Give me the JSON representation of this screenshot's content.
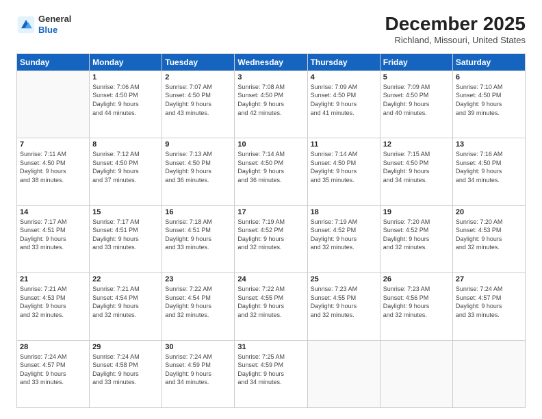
{
  "logo": {
    "general": "General",
    "blue": "Blue"
  },
  "header": {
    "month": "December 2025",
    "location": "Richland, Missouri, United States"
  },
  "days_of_week": [
    "Sunday",
    "Monday",
    "Tuesday",
    "Wednesday",
    "Thursday",
    "Friday",
    "Saturday"
  ],
  "weeks": [
    [
      {
        "day": "",
        "info": ""
      },
      {
        "day": "1",
        "info": "Sunrise: 7:06 AM\nSunset: 4:50 PM\nDaylight: 9 hours\nand 44 minutes."
      },
      {
        "day": "2",
        "info": "Sunrise: 7:07 AM\nSunset: 4:50 PM\nDaylight: 9 hours\nand 43 minutes."
      },
      {
        "day": "3",
        "info": "Sunrise: 7:08 AM\nSunset: 4:50 PM\nDaylight: 9 hours\nand 42 minutes."
      },
      {
        "day": "4",
        "info": "Sunrise: 7:09 AM\nSunset: 4:50 PM\nDaylight: 9 hours\nand 41 minutes."
      },
      {
        "day": "5",
        "info": "Sunrise: 7:09 AM\nSunset: 4:50 PM\nDaylight: 9 hours\nand 40 minutes."
      },
      {
        "day": "6",
        "info": "Sunrise: 7:10 AM\nSunset: 4:50 PM\nDaylight: 9 hours\nand 39 minutes."
      }
    ],
    [
      {
        "day": "7",
        "info": "Sunrise: 7:11 AM\nSunset: 4:50 PM\nDaylight: 9 hours\nand 38 minutes."
      },
      {
        "day": "8",
        "info": "Sunrise: 7:12 AM\nSunset: 4:50 PM\nDaylight: 9 hours\nand 37 minutes."
      },
      {
        "day": "9",
        "info": "Sunrise: 7:13 AM\nSunset: 4:50 PM\nDaylight: 9 hours\nand 36 minutes."
      },
      {
        "day": "10",
        "info": "Sunrise: 7:14 AM\nSunset: 4:50 PM\nDaylight: 9 hours\nand 36 minutes."
      },
      {
        "day": "11",
        "info": "Sunrise: 7:14 AM\nSunset: 4:50 PM\nDaylight: 9 hours\nand 35 minutes."
      },
      {
        "day": "12",
        "info": "Sunrise: 7:15 AM\nSunset: 4:50 PM\nDaylight: 9 hours\nand 34 minutes."
      },
      {
        "day": "13",
        "info": "Sunrise: 7:16 AM\nSunset: 4:50 PM\nDaylight: 9 hours\nand 34 minutes."
      }
    ],
    [
      {
        "day": "14",
        "info": "Sunrise: 7:17 AM\nSunset: 4:51 PM\nDaylight: 9 hours\nand 33 minutes."
      },
      {
        "day": "15",
        "info": "Sunrise: 7:17 AM\nSunset: 4:51 PM\nDaylight: 9 hours\nand 33 minutes."
      },
      {
        "day": "16",
        "info": "Sunrise: 7:18 AM\nSunset: 4:51 PM\nDaylight: 9 hours\nand 33 minutes."
      },
      {
        "day": "17",
        "info": "Sunrise: 7:19 AM\nSunset: 4:52 PM\nDaylight: 9 hours\nand 32 minutes."
      },
      {
        "day": "18",
        "info": "Sunrise: 7:19 AM\nSunset: 4:52 PM\nDaylight: 9 hours\nand 32 minutes."
      },
      {
        "day": "19",
        "info": "Sunrise: 7:20 AM\nSunset: 4:52 PM\nDaylight: 9 hours\nand 32 minutes."
      },
      {
        "day": "20",
        "info": "Sunrise: 7:20 AM\nSunset: 4:53 PM\nDaylight: 9 hours\nand 32 minutes."
      }
    ],
    [
      {
        "day": "21",
        "info": "Sunrise: 7:21 AM\nSunset: 4:53 PM\nDaylight: 9 hours\nand 32 minutes."
      },
      {
        "day": "22",
        "info": "Sunrise: 7:21 AM\nSunset: 4:54 PM\nDaylight: 9 hours\nand 32 minutes."
      },
      {
        "day": "23",
        "info": "Sunrise: 7:22 AM\nSunset: 4:54 PM\nDaylight: 9 hours\nand 32 minutes."
      },
      {
        "day": "24",
        "info": "Sunrise: 7:22 AM\nSunset: 4:55 PM\nDaylight: 9 hours\nand 32 minutes."
      },
      {
        "day": "25",
        "info": "Sunrise: 7:23 AM\nSunset: 4:55 PM\nDaylight: 9 hours\nand 32 minutes."
      },
      {
        "day": "26",
        "info": "Sunrise: 7:23 AM\nSunset: 4:56 PM\nDaylight: 9 hours\nand 32 minutes."
      },
      {
        "day": "27",
        "info": "Sunrise: 7:24 AM\nSunset: 4:57 PM\nDaylight: 9 hours\nand 33 minutes."
      }
    ],
    [
      {
        "day": "28",
        "info": "Sunrise: 7:24 AM\nSunset: 4:57 PM\nDaylight: 9 hours\nand 33 minutes."
      },
      {
        "day": "29",
        "info": "Sunrise: 7:24 AM\nSunset: 4:58 PM\nDaylight: 9 hours\nand 33 minutes."
      },
      {
        "day": "30",
        "info": "Sunrise: 7:24 AM\nSunset: 4:59 PM\nDaylight: 9 hours\nand 34 minutes."
      },
      {
        "day": "31",
        "info": "Sunrise: 7:25 AM\nSunset: 4:59 PM\nDaylight: 9 hours\nand 34 minutes."
      },
      {
        "day": "",
        "info": ""
      },
      {
        "day": "",
        "info": ""
      },
      {
        "day": "",
        "info": ""
      }
    ]
  ]
}
